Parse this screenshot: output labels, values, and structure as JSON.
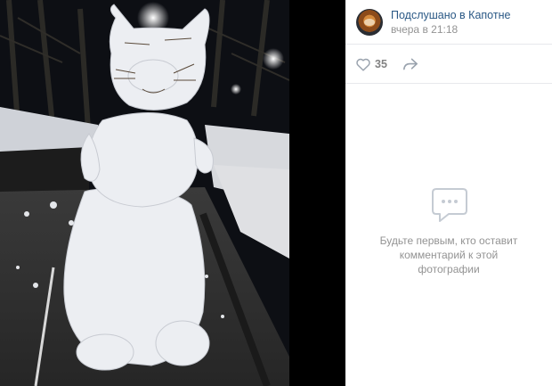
{
  "post": {
    "author": "Подслушано в Капотне",
    "time": "вчера в 21:18",
    "likes": "35"
  },
  "comments": {
    "empty_text": "Будьте первым, кто оставит комментарий к этой фотографии"
  },
  "icons": {
    "like": "heart-icon",
    "share": "share-arrow-icon",
    "empty": "comment-bubble-icon"
  },
  "colors": {
    "link": "#2a5885",
    "muted": "#939393",
    "icon": "#99a2ad"
  }
}
